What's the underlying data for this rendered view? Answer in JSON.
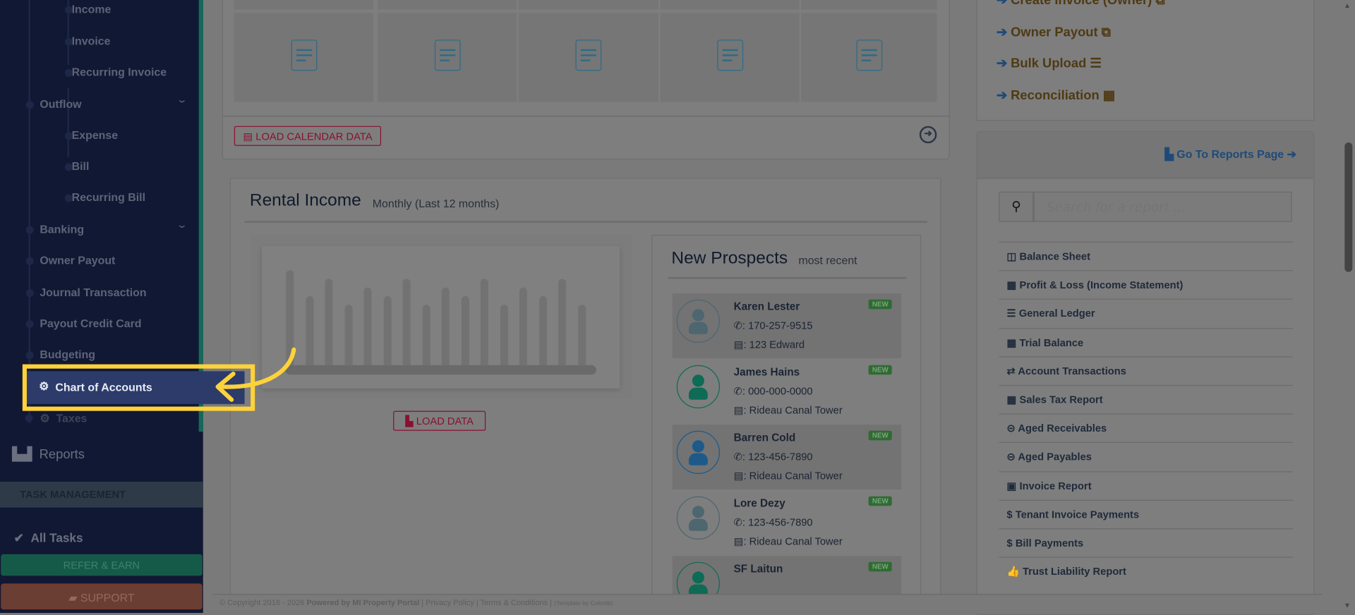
{
  "sidebar": {
    "items": [
      {
        "label": "Income",
        "level": 2,
        "chevron": false
      },
      {
        "label": "Invoice",
        "level": 2,
        "chevron": false
      },
      {
        "label": "Recurring Invoice",
        "level": 2,
        "chevron": false
      },
      {
        "label": "Outflow",
        "level": 1,
        "chevron": true
      },
      {
        "label": "Expense",
        "level": 2,
        "chevron": false
      },
      {
        "label": "Bill",
        "level": 2,
        "chevron": false
      },
      {
        "label": "Recurring Bill",
        "level": 2,
        "chevron": false
      },
      {
        "label": "Banking",
        "level": 1,
        "chevron": true
      },
      {
        "label": "Owner Payout",
        "level": 1,
        "chevron": false
      },
      {
        "label": "Journal Transaction",
        "level": 1,
        "chevron": false
      },
      {
        "label": "Payout Credit Card",
        "level": 1,
        "chevron": false
      },
      {
        "label": "Budgeting",
        "level": 1,
        "chevron": false
      }
    ],
    "highlighted": "Chart of Accounts",
    "taxes": "Taxes",
    "reports": "Reports",
    "task_section": "TASK MANAGEMENT",
    "all_tasks": "All Tasks",
    "refer": "REFER & EARN",
    "support": "SUPPORT"
  },
  "calendar": {
    "load_button": "LOAD CALENDAR DATA"
  },
  "rental_income": {
    "title": "Rental Income",
    "subtitle": "Monthly (Last 12 months)",
    "load_button": "LOAD DATA"
  },
  "prospects": {
    "title": "New Prospects",
    "subtitle": "most recent",
    "badge": "NEW",
    "items": [
      {
        "name": "Karen Lester",
        "phone": "170-257-9515",
        "address": "123 Edward",
        "color": "#4d6670"
      },
      {
        "name": "James Hains",
        "phone": "000-000-0000",
        "address": "Rideau Canal Tower",
        "color": "#0e6b55"
      },
      {
        "name": "Barren Cold",
        "phone": "123-456-7890",
        "address": "Rideau Canal Tower",
        "color": "#1d5a8a"
      },
      {
        "name": "Lore Dezy",
        "phone": "123-456-7890",
        "address": "Rideau Canal Tower",
        "color": "#4d6670"
      },
      {
        "name": "SF Laitun",
        "phone": "",
        "address": "",
        "color": "#0e6b55"
      }
    ]
  },
  "quick_links": [
    {
      "label": "Create Invoice (Owner)",
      "icon": "copy-icon"
    },
    {
      "label": "Owner Payout",
      "icon": "copy-icon"
    },
    {
      "label": "Bulk Upload",
      "icon": "database-icon"
    },
    {
      "label": "Reconciliation",
      "icon": "calculator-icon"
    }
  ],
  "reports_panel": {
    "go_to": "Go To Reports Page",
    "search_placeholder": "Search for a report ...",
    "items": [
      {
        "icon": "◫",
        "label": "Balance Sheet"
      },
      {
        "icon": "▦",
        "label": "Profit & Loss (Income Statement)"
      },
      {
        "icon": "☰",
        "label": "General Ledger"
      },
      {
        "icon": "▦",
        "label": "Trial Balance"
      },
      {
        "icon": "⇄",
        "label": "Account Transactions"
      },
      {
        "icon": "▦",
        "label": "Sales Tax Report"
      },
      {
        "icon": "⊝",
        "label": "Aged Receivables"
      },
      {
        "icon": "⊝",
        "label": "Aged Payables"
      },
      {
        "icon": "▣",
        "label": "Invoice Report"
      },
      {
        "icon": "$",
        "label": "Tenant Invoice Payments"
      },
      {
        "icon": "$",
        "label": "Bill Payments"
      },
      {
        "icon": "👍",
        "label": "Trust Liability Report"
      }
    ]
  },
  "footer": {
    "copyright": "© Copyright 2016 - 2026",
    "powered": "Powered by MI Property Portal",
    "privacy": "Privacy Policy",
    "terms": "Terms & Conditions",
    "template": "(Template by Colorlib)"
  }
}
